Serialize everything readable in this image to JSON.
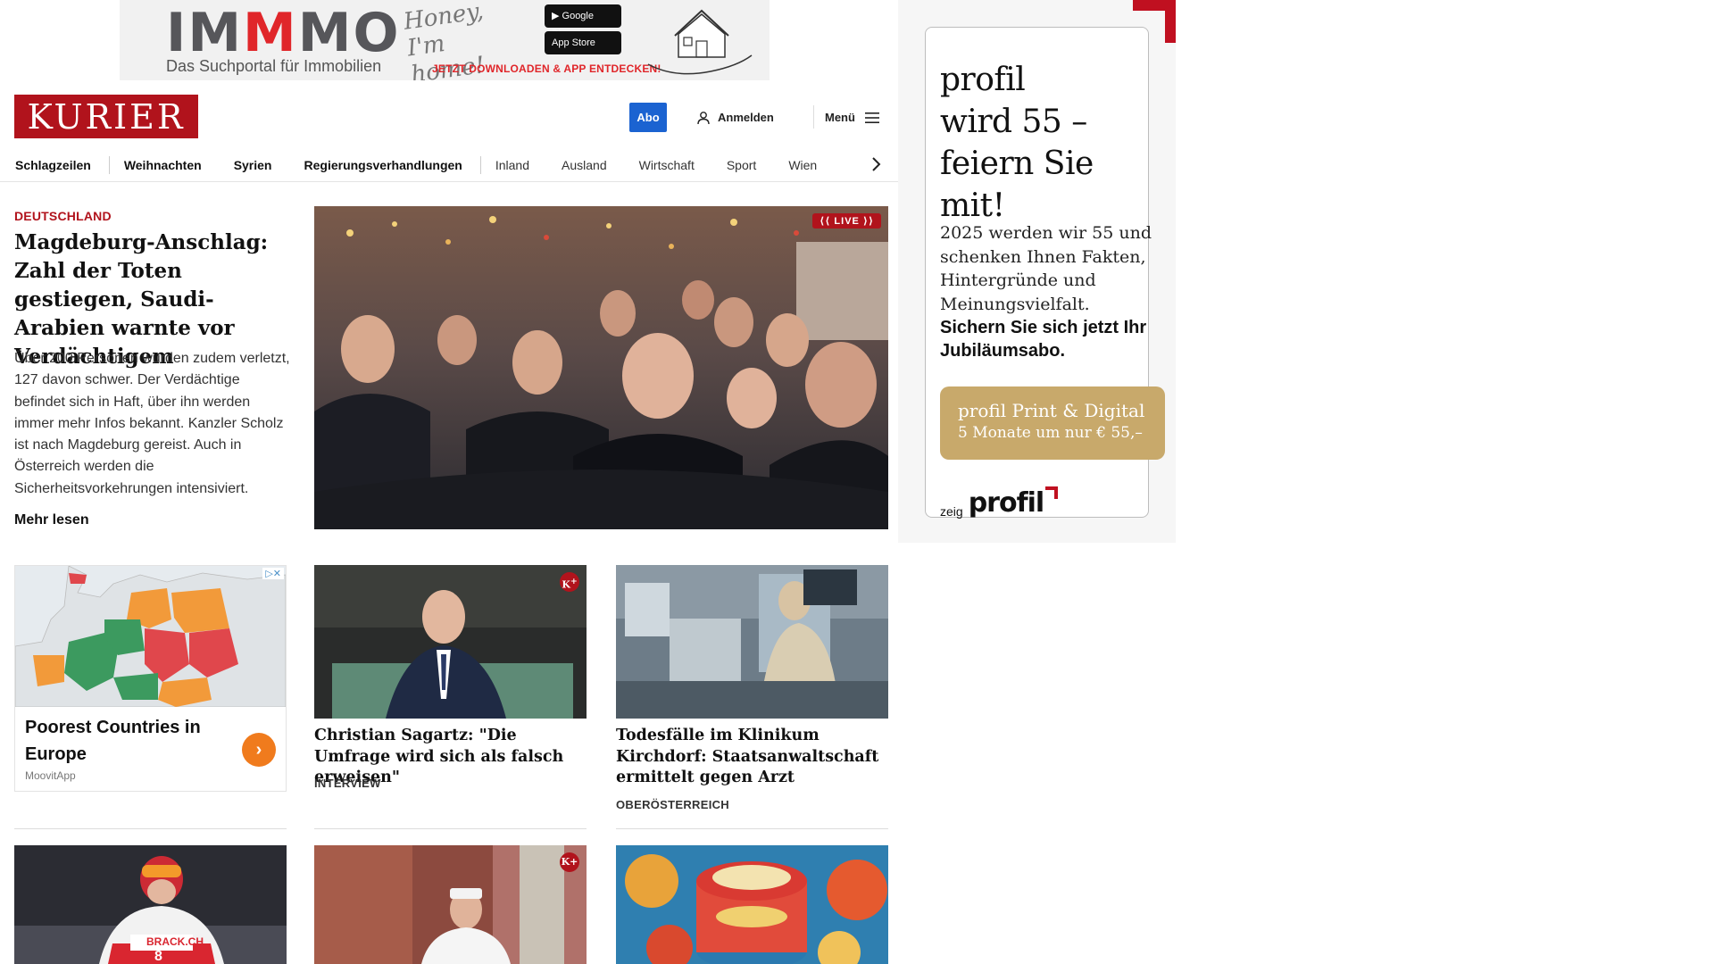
{
  "banner_ad": {
    "logo": "IMMMO",
    "tagline": "Das Suchportal für Immobilien",
    "script_text": "Honey, I'm home!",
    "google_play": "Google Play",
    "app_store": "App Store",
    "cta": "JETZT DOWNLOADEN & APP ENTDECKEN!"
  },
  "header": {
    "logo": "KURIER",
    "abo": "Abo",
    "login": "Anmelden",
    "menu": "Menü"
  },
  "nav": {
    "items": [
      "Schlagzeilen",
      "Weihnachten",
      "Syrien",
      "Regierungsverhandlungen",
      "Inland",
      "Ausland",
      "Wirtschaft",
      "Sport",
      "Wien"
    ]
  },
  "lead": {
    "kicker": "DEUTSCHLAND",
    "headline": "Magdeburg-Anschlag: Zahl der Toten gestiegen, Saudi-Arabien warnte vor Verdächtigem",
    "teaser": "Über 200 Personen wurden zudem verletzt, 127 davon schwer. Der Verdächtige befindet sich in Haft, über ihn werden immer mehr Infos bekannt. Kanzler Scholz ist nach Magdeburg gereist. Auch in Österreich werden die Sicherheitsvorkehrungen intensiviert.",
    "more": "Mehr lesen",
    "live": "LIVE"
  },
  "native_ad": {
    "title": "Poorest Countries in Europe",
    "source": "MoovitApp"
  },
  "cards": [
    {
      "title": "Christian Sagartz: \"Die Umfrage wird sich als falsch erweisen\"",
      "tag": "INTERVIEW",
      "premium": "K+"
    },
    {
      "title": "Todesfälle im Klinikum Kirchdorf: Staatsanwaltschaft ermittelt gegen Arzt",
      "tag": "OBERÖSTERREICH"
    }
  ],
  "bottom_cards": [
    {
      "bib": "8",
      "sponsor": "BRACK.CH"
    },
    {
      "premium": "K+"
    },
    {}
  ],
  "side_ad": {
    "headline_1": "profil",
    "headline_2": "wird 55 –",
    "headline_3": "feiern Sie mit!",
    "body": "2025 werden wir 55 und schenken Ihnen Fakten, Hintergründe und Meinungsvielfalt.",
    "body_bold": "Sichern Sie sich jetzt Ihr Jubiläumsabo.",
    "offer_1": "profil Print & Digital",
    "offer_2": "5 Monate um nur € 55,–",
    "brand_prefix": "zeig",
    "brand": "profil"
  },
  "colors": {
    "brand_red": "#b1131c",
    "abo_blue": "#1b63d1",
    "ad_gold": "#c8a96b",
    "ad_orange": "#f07b1d"
  }
}
